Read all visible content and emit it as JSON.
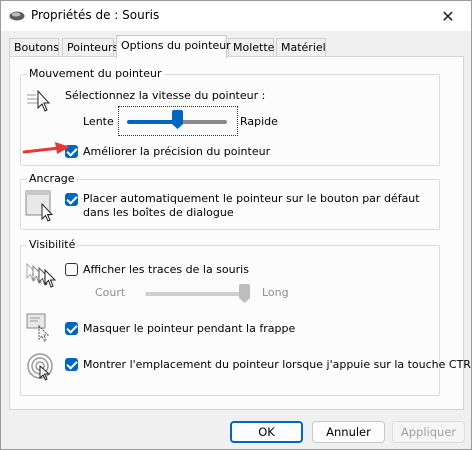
{
  "window": {
    "title": "Propriétés de : Souris",
    "close_label": "✕"
  },
  "tabs": [
    {
      "label": "Boutons"
    },
    {
      "label": "Pointeurs"
    },
    {
      "label": "Options du pointeur"
    },
    {
      "label": "Molette"
    },
    {
      "label": "Matériel"
    }
  ],
  "motion": {
    "title": "Mouvement du pointeur",
    "speed_label": "Sélectionnez la vitesse du pointeur :",
    "slow_label": "Lente",
    "fast_label": "Rapide",
    "speed_level": 0.5,
    "enhance_label": "Améliorer la précision du pointeur",
    "enhance_checked": true
  },
  "snap": {
    "title": "Ancrage",
    "label": "Placer automatiquement le pointeur sur le bouton par défaut dans les boîtes de dialogue",
    "checked": true
  },
  "visibility": {
    "title": "Visibilité",
    "trails_label": "Afficher les traces de la souris",
    "trails_checked": false,
    "short_label": "Court",
    "long_label": "Long",
    "trail_level": 1.0,
    "hide_label": "Masquer le pointeur pendant la frappe",
    "hide_checked": true,
    "ctrl_label": "Montrer l'emplacement du pointeur lorsque j'appuie sur la touche CTRL",
    "ctrl_checked": true
  },
  "buttons": {
    "ok": "OK",
    "cancel": "Annuler",
    "apply": "Appliquer"
  },
  "colors": {
    "accent": "#0067c0",
    "arrow": "#e53935"
  }
}
